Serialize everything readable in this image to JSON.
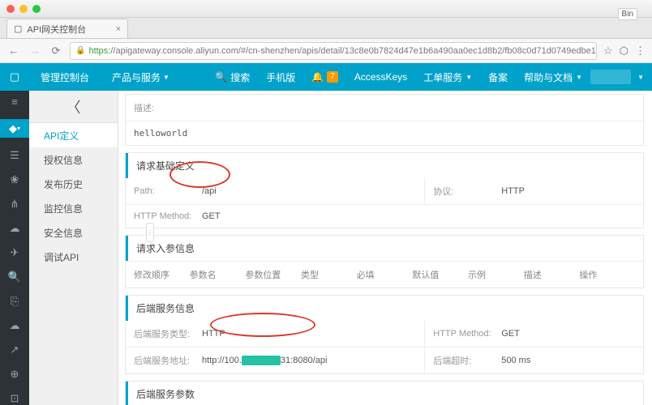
{
  "browser": {
    "tab_title": "API网关控制台",
    "bin_label": "Bin",
    "url_https": "https",
    "url_rest": "://apigateway.console.aliyun.com/#/cn-shenzhen/apis/detail/13c8e0b7824d47e1b6a490aa0ec1d8b2/fb08c0d71d0749edbe1cd0e…"
  },
  "appbar": {
    "console": "管理控制台",
    "products": "产品与服务",
    "search": "搜索",
    "mobile": "手机版",
    "notif_count": "7",
    "accesskeys": "AccessKeys",
    "workorder": "工单服务",
    "beian": "备案",
    "help": "帮助与文档"
  },
  "sidebar": {
    "items": [
      {
        "label": "API定义"
      },
      {
        "label": "授权信息"
      },
      {
        "label": "发布历史"
      },
      {
        "label": "监控信息"
      },
      {
        "label": "安全信息"
      },
      {
        "label": "调试API"
      }
    ]
  },
  "desc": {
    "label": "描述:",
    "value": "helloworld"
  },
  "sections": {
    "req_base": "请求基础定义",
    "req_params": "请求入参信息",
    "backend": "后端服务信息",
    "backend_params": "后端服务参数"
  },
  "req_base": {
    "path_lbl": "Path:",
    "path_val": "/api",
    "proto_lbl": "协议:",
    "proto_val": "HTTP",
    "method_lbl": "HTTP Method:",
    "method_val": "GET"
  },
  "param_headers": [
    "修改顺序",
    "参数名",
    "参数位置",
    "类型",
    "必填",
    "默认值",
    "示例",
    "描述",
    "操作"
  ],
  "backend": {
    "type_lbl": "后端服务类型:",
    "type_val": "HTTP",
    "method_lbl": "HTTP Method:",
    "method_val": "GET",
    "addr_lbl": "后端服务地址:",
    "addr_pre": "http://100.",
    "addr_suf": "31:8080/api",
    "timeout_lbl": "后端超时:",
    "timeout_val": "500 ms"
  }
}
